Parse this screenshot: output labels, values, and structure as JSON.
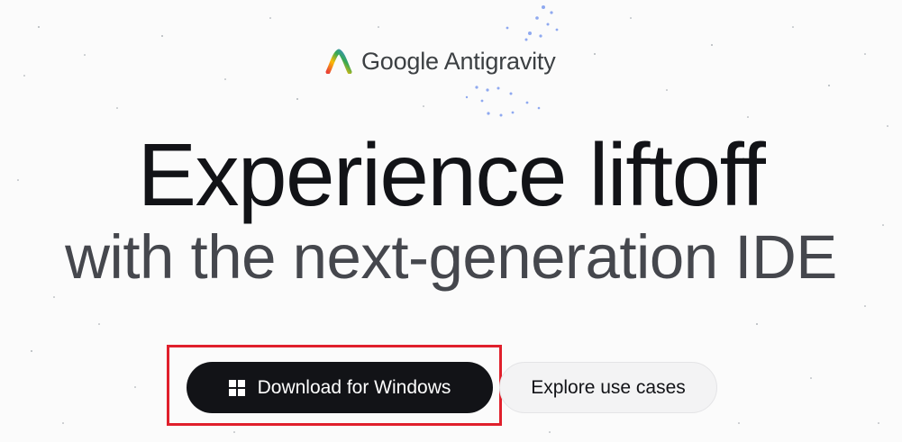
{
  "brand": {
    "google": "Google",
    "product": "Antigravity",
    "logo_icon": "antigravity-logo-icon"
  },
  "hero": {
    "headline": "Experience liftoff",
    "subheadline": "with the next-generation IDE"
  },
  "actions": {
    "primary_label": "Download for Windows",
    "primary_icon": "windows-icon",
    "secondary_label": "Explore use cases"
  },
  "colors": {
    "text_dark": "#121317",
    "text_muted": "#45474d",
    "highlight": "#e0202c",
    "secondary_bg": "#f3f3f4"
  }
}
